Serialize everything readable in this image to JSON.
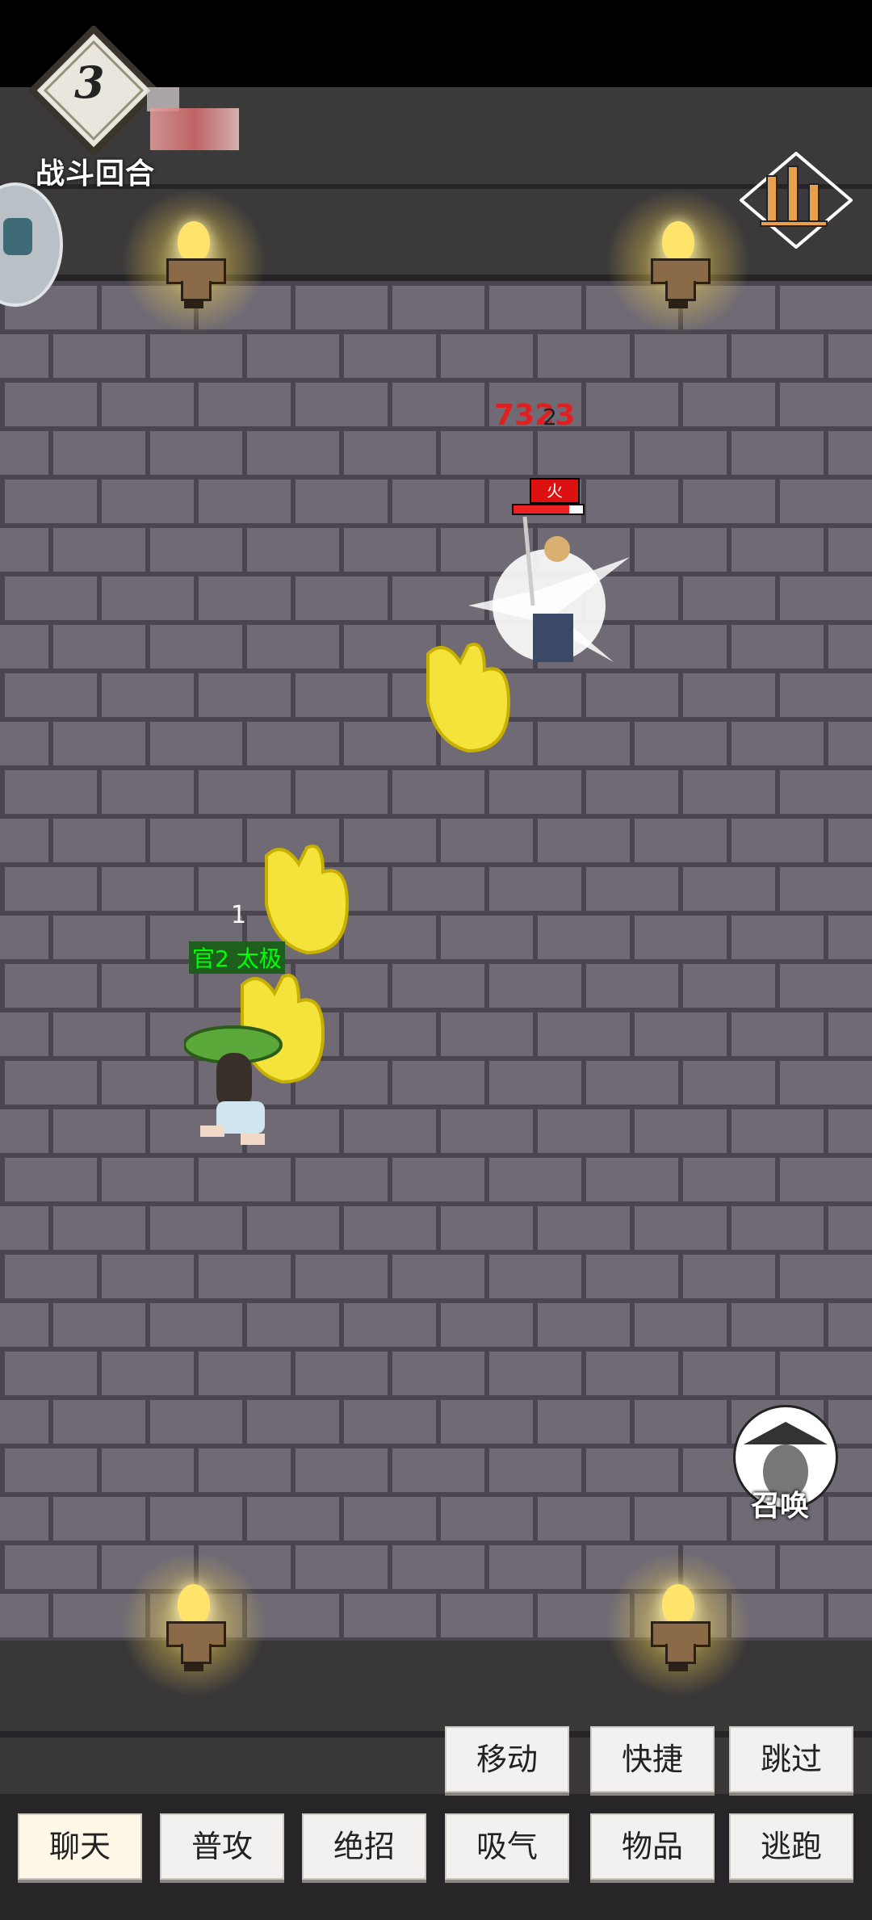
{
  "battle": {
    "round_number": "3",
    "round_label": "战斗回合"
  },
  "enemy": {
    "damage_value": "7323",
    "damage_hits": "2",
    "status_tag": "火",
    "hp_fraction": 0.8
  },
  "player": {
    "count_label": "1",
    "status_tag": "官2  太极"
  },
  "summon": {
    "label": "召唤"
  },
  "actions": {
    "row1": [
      "移动",
      "快捷",
      "跳过"
    ],
    "row2": [
      "聊天",
      "普攻",
      "绝招",
      "吸气",
      "物品",
      "逃跑"
    ]
  },
  "colors": {
    "brick": "#6f6a74",
    "mortar": "#4a454f",
    "damage": "#e02020",
    "player_tag": "#00ff00",
    "torch_glow": "#ffe36a"
  },
  "icons": {
    "stats_button": "bar-chart-icon",
    "side_button": "side-menu-icon"
  }
}
